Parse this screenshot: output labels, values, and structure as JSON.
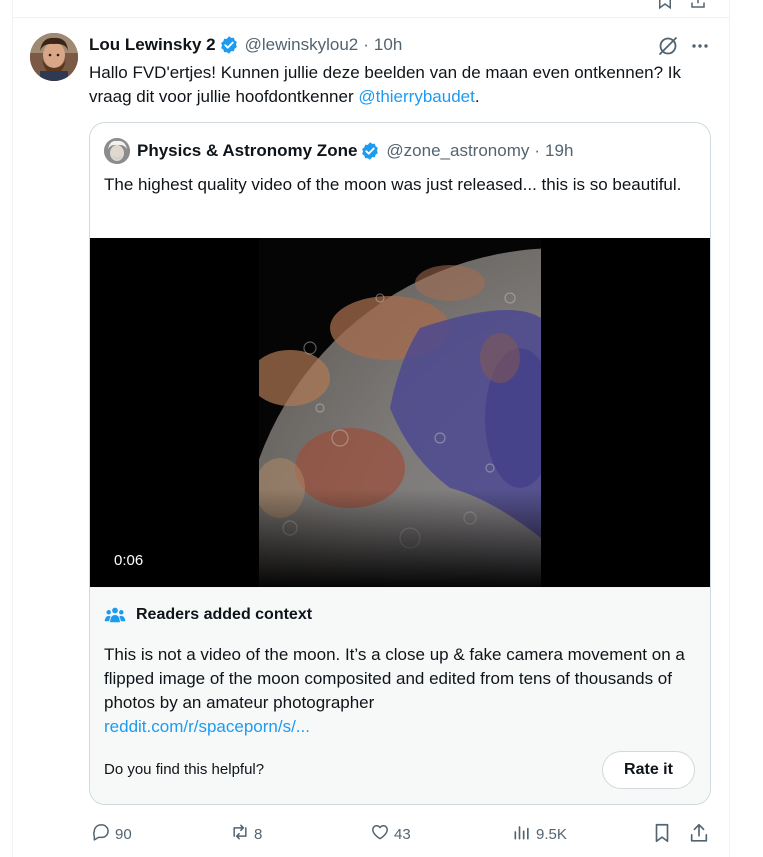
{
  "author": {
    "display_name": "Lou Lewinsky 2",
    "handle": "@lewinskylou2",
    "separator": "·",
    "time": "10h"
  },
  "tweet": {
    "text_before": "Hallo FVD'ertjes! Kunnen jullie deze beelden van de maan even ontkennen? Ik vraag dit voor jullie hoofdontkenner ",
    "mention": "@thierrybaudet",
    "text_after": "."
  },
  "quoted": {
    "display_name": "Physics & Astronomy Zone",
    "handle": "@zone_astronomy",
    "separator": "·",
    "time": "19h",
    "text": "The highest quality video of the moon was just released... this is so beautiful.",
    "video_duration": "0:06"
  },
  "community_note": {
    "title": "Readers added context",
    "body": "This is not a video of the moon. It’s a close up & fake camera movement on a flipped image of the moon composited and edited from tens of thousands of photos by an amateur photographer",
    "link": "reddit.com/r/spaceporn/s/...",
    "question": "Do you find this helpful?",
    "rate_label": "Rate it"
  },
  "actions": {
    "replies": "90",
    "reposts": "8",
    "likes": "43",
    "views": "9.5K"
  },
  "icons": {
    "verified": "verified-badge-icon",
    "grok": "grok-icon",
    "more": "more-icon",
    "context": "people-icon",
    "reply": "reply-icon",
    "repost": "repost-icon",
    "like": "heart-icon",
    "views": "views-icon",
    "bookmark": "bookmark-icon",
    "share": "share-icon"
  },
  "colors": {
    "accent": "#1d9bf0",
    "text": "#0f1419",
    "muted": "#536471",
    "border": "#cfd9de",
    "note_background": "#f7f9f9"
  }
}
